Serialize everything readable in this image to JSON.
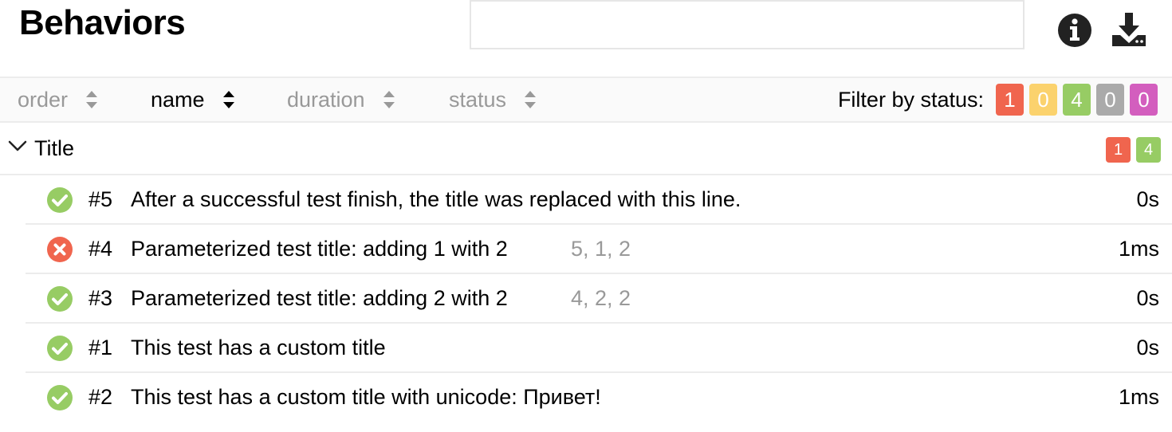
{
  "header": {
    "title": "Behaviors",
    "search_value": "",
    "info_icon": "info-icon",
    "download_icon": "download-icon"
  },
  "sort": {
    "columns": [
      {
        "label": "order",
        "active": false
      },
      {
        "label": "name",
        "active": true
      },
      {
        "label": "duration",
        "active": false
      },
      {
        "label": "status",
        "active": false
      }
    ]
  },
  "filter": {
    "label": "Filter by status:",
    "counts": {
      "failed": "1",
      "broken": "0",
      "passed": "4",
      "skipped": "0",
      "unknown": "0"
    }
  },
  "colors": {
    "failed": "#f0654e",
    "broken": "#fbd26d",
    "passed": "#97cc64",
    "skipped": "#aaaaaa",
    "unknown": "#d35ebe"
  },
  "group": {
    "title": "Title",
    "expanded": true,
    "counts": {
      "failed": "1",
      "passed": "4"
    }
  },
  "tests": [
    {
      "order": "#5",
      "name": "After a successful test finish, the title was replaced with this line.",
      "params": "",
      "duration": "0s",
      "status": "passed"
    },
    {
      "order": "#4",
      "name": "Parameterized test title: adding 1 with 2",
      "params": "5, 1, 2",
      "duration": "1ms",
      "status": "failed"
    },
    {
      "order": "#3",
      "name": "Parameterized test title: adding 2 with 2",
      "params": "4, 2, 2",
      "duration": "0s",
      "status": "passed"
    },
    {
      "order": "#1",
      "name": "This test has a custom title",
      "params": "",
      "duration": "0s",
      "status": "passed"
    },
    {
      "order": "#2",
      "name": "This test has a custom title with unicode: Привет!",
      "params": "",
      "duration": "1ms",
      "status": "passed"
    }
  ]
}
